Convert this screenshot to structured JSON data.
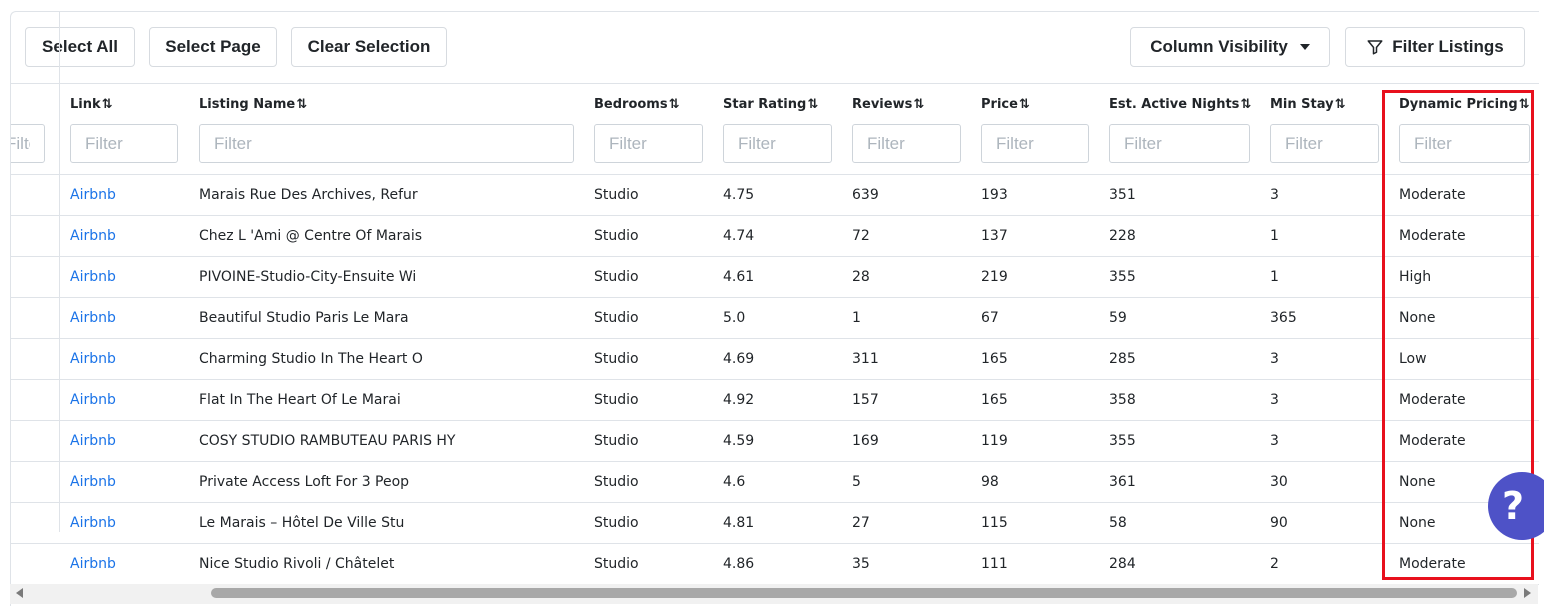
{
  "toolbar": {
    "select_all": "Select All",
    "select_page": "Select Page",
    "clear_selection": "Clear Selection",
    "column_visibility": "Column Visibility",
    "filter_listings": "Filter Listings"
  },
  "columns": [
    {
      "key": "link",
      "label": "Link"
    },
    {
      "key": "name",
      "label": "Listing Name"
    },
    {
      "key": "bedrooms",
      "label": "Bedrooms"
    },
    {
      "key": "rating",
      "label": "Star Rating"
    },
    {
      "key": "reviews",
      "label": "Reviews"
    },
    {
      "key": "price",
      "label": "Price"
    },
    {
      "key": "nights",
      "label": "Est. Active Nights"
    },
    {
      "key": "minstay",
      "label": "Min Stay"
    },
    {
      "key": "dynamic",
      "label": "Dynamic Pricing"
    }
  ],
  "sort_icon": "⇅",
  "filter_placeholder": "Filter",
  "rows": [
    {
      "link": "Airbnb",
      "name": "Marais Rue Des Archives, Refur",
      "bedrooms": "Studio",
      "rating": "4.75",
      "reviews": "639",
      "price": "193",
      "nights": "351",
      "minstay": "3",
      "dynamic": "Moderate"
    },
    {
      "link": "Airbnb",
      "name": "Chez L 'Ami @ Centre Of Marais",
      "bedrooms": "Studio",
      "rating": "4.74",
      "reviews": "72",
      "price": "137",
      "nights": "228",
      "minstay": "1",
      "dynamic": "Moderate"
    },
    {
      "link": "Airbnb",
      "name": "PIVOINE-Studio-City-Ensuite Wi",
      "bedrooms": "Studio",
      "rating": "4.61",
      "reviews": "28",
      "price": "219",
      "nights": "355",
      "minstay": "1",
      "dynamic": "High"
    },
    {
      "link": "Airbnb",
      "name": "Beautiful Studio Paris Le Mara",
      "bedrooms": "Studio",
      "rating": "5.0",
      "reviews": "1",
      "price": "67",
      "nights": "59",
      "minstay": "365",
      "dynamic": "None"
    },
    {
      "link": "Airbnb",
      "name": "Charming Studio In The Heart O",
      "bedrooms": "Studio",
      "rating": "4.69",
      "reviews": "311",
      "price": "165",
      "nights": "285",
      "minstay": "3",
      "dynamic": "Low"
    },
    {
      "link": "Airbnb",
      "name": "Flat In The Heart Of Le Marai",
      "bedrooms": "Studio",
      "rating": "4.92",
      "reviews": "157",
      "price": "165",
      "nights": "358",
      "minstay": "3",
      "dynamic": "Moderate"
    },
    {
      "link": "Airbnb",
      "name": "COSY STUDIO RAMBUTEAU PARIS HY",
      "bedrooms": "Studio",
      "rating": "4.59",
      "reviews": "169",
      "price": "119",
      "nights": "355",
      "minstay": "3",
      "dynamic": "Moderate"
    },
    {
      "link": "Airbnb",
      "name": "Private Access Loft For 3 Peop",
      "bedrooms": "Studio",
      "rating": "4.6",
      "reviews": "5",
      "price": "98",
      "nights": "361",
      "minstay": "30",
      "dynamic": "None"
    },
    {
      "link": "Airbnb",
      "name": "Le Marais – Hôtel De Ville Stu",
      "bedrooms": "Studio",
      "rating": "4.81",
      "reviews": "27",
      "price": "115",
      "nights": "58",
      "minstay": "90",
      "dynamic": "None"
    },
    {
      "link": "Airbnb",
      "name": "Nice Studio Rivoli / Châtelet",
      "bedrooms": "Studio",
      "rating": "4.86",
      "reviews": "35",
      "price": "111",
      "nights": "284",
      "minstay": "2",
      "dynamic": "Moderate"
    }
  ],
  "help_icon": "?",
  "colors": {
    "link": "#1a73e8",
    "highlight_border": "#e8101d",
    "help_button": "#4e52c7",
    "border": "#dfe3e8"
  }
}
